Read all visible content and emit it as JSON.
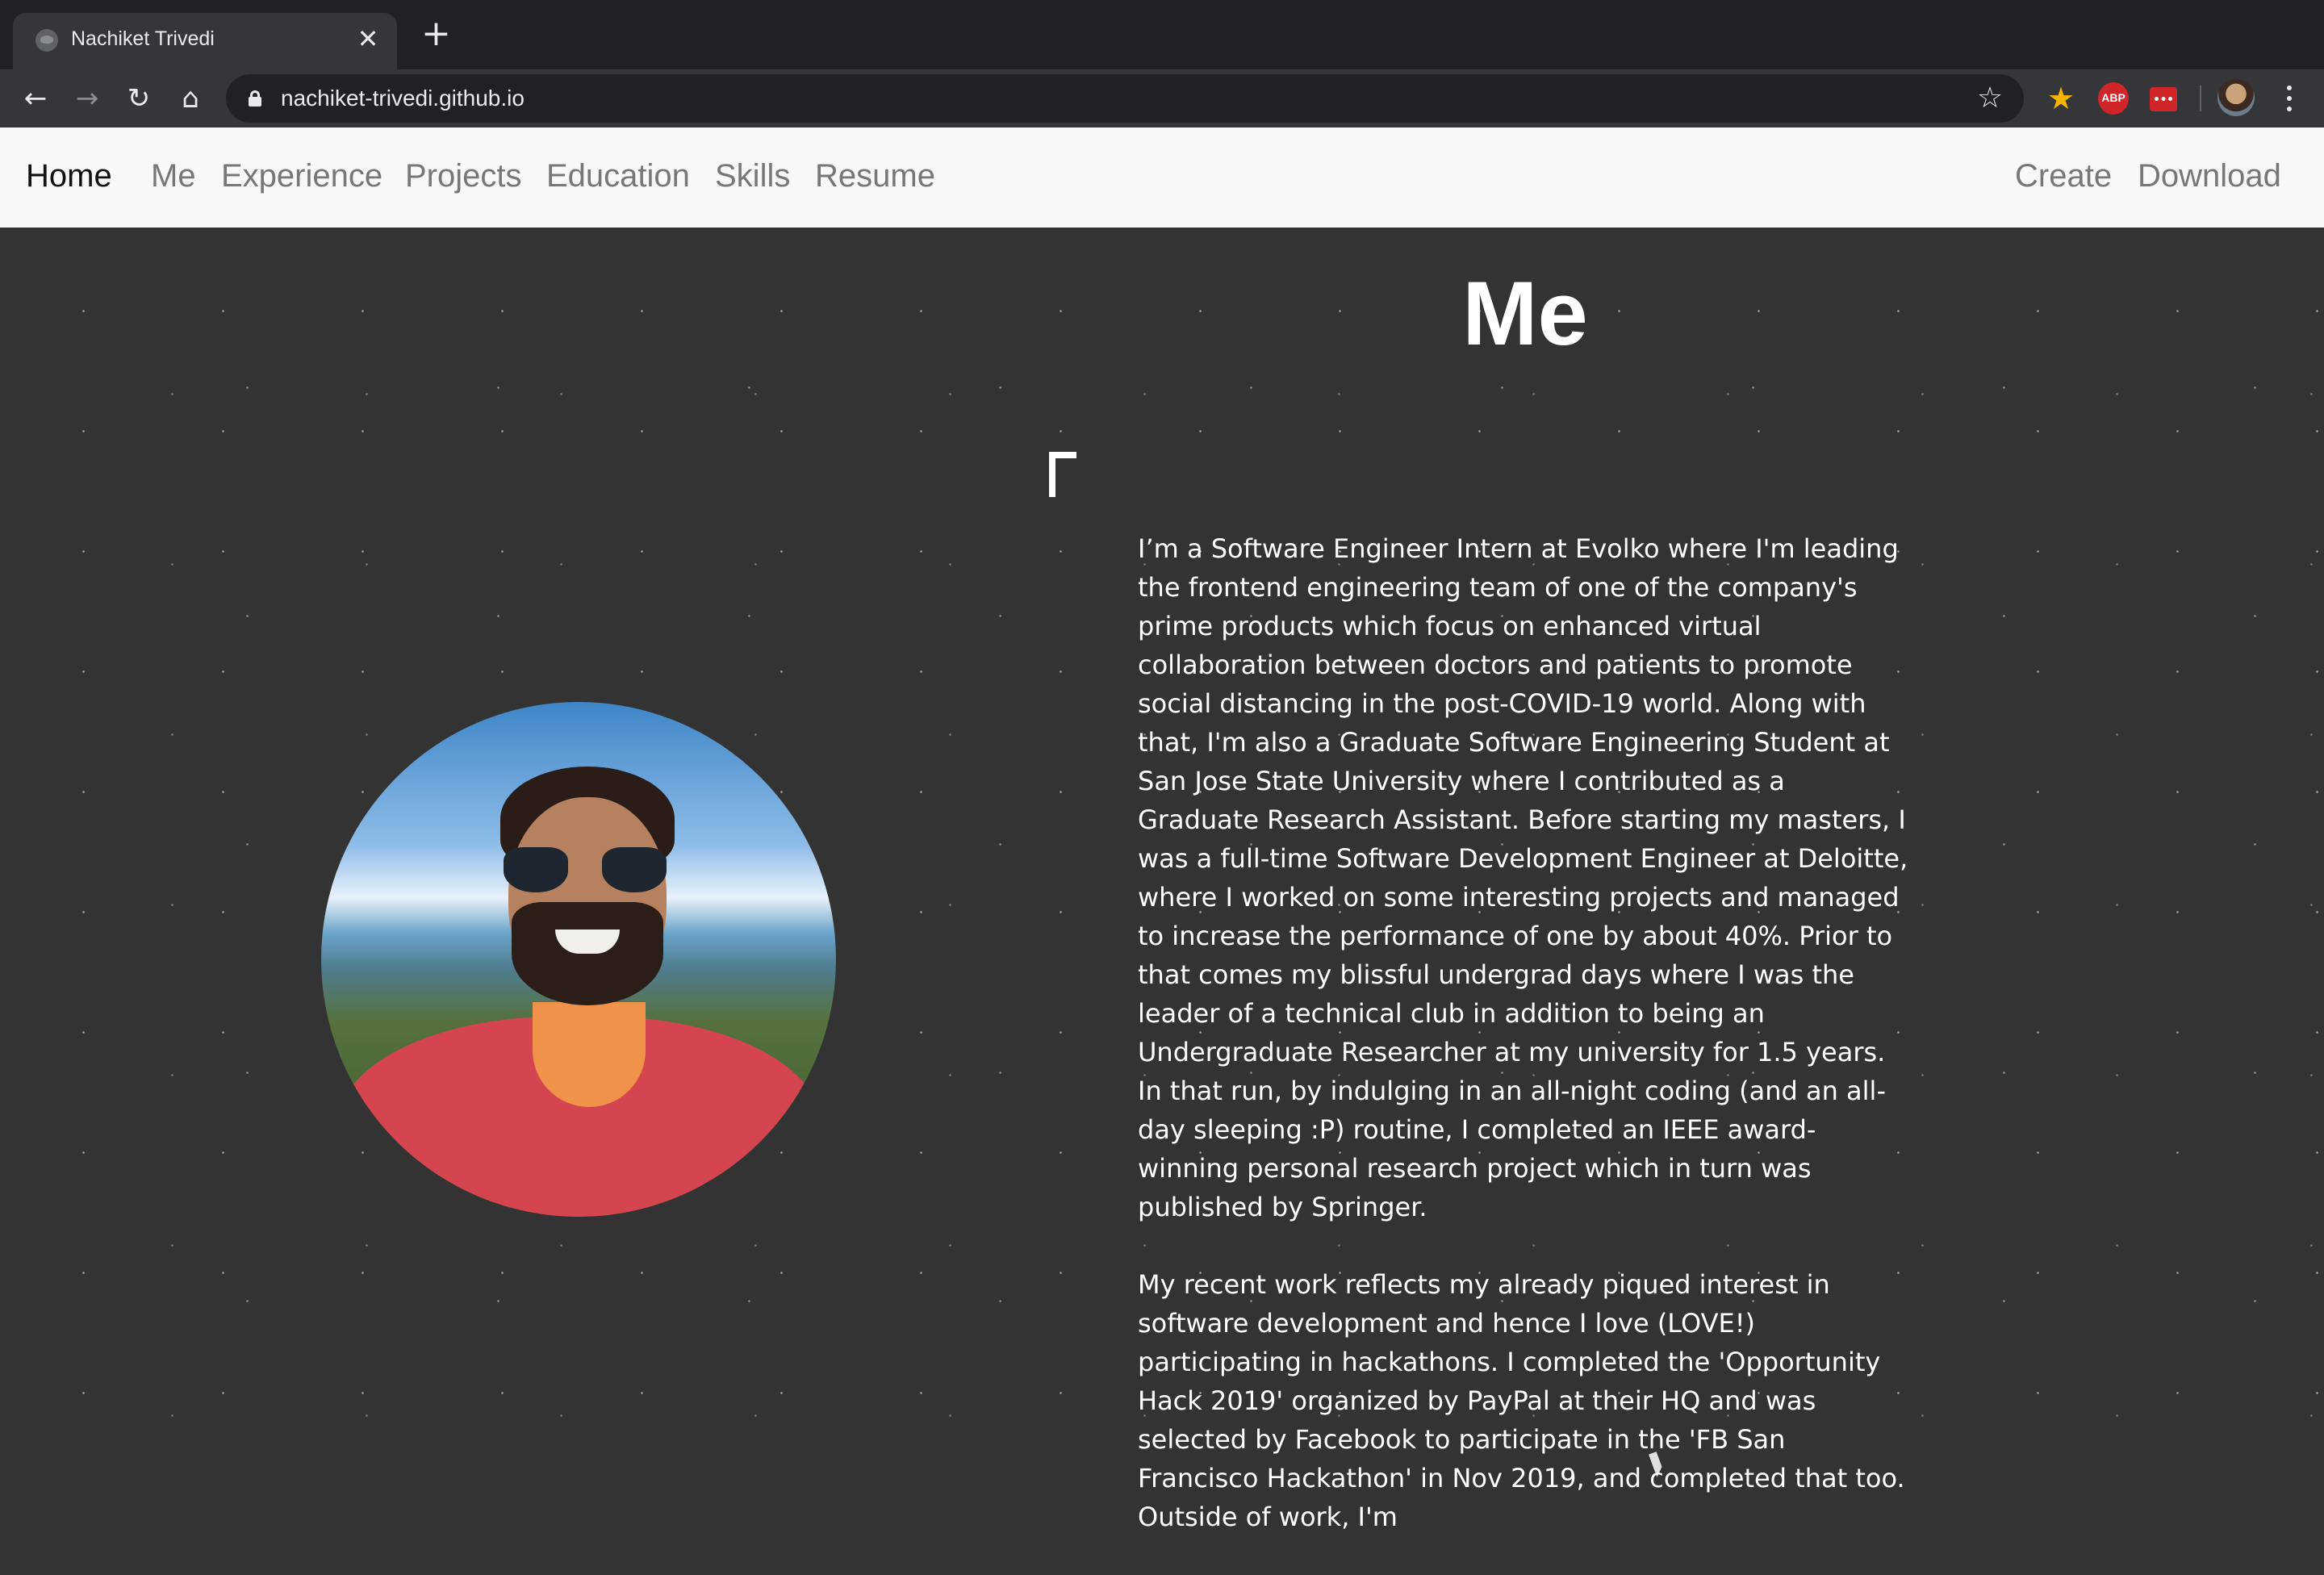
{
  "browser": {
    "tab_title": "Nachiket Trivedi",
    "tab_close": "✕",
    "new_tab": "+",
    "url": "nachiket-trivedi.github.io",
    "back": "←",
    "forward": "→",
    "reload": "↻",
    "home": "⌂",
    "bookmark_star": "☆",
    "ext_star": "★",
    "ext_abp_label": "ABP"
  },
  "navbar": {
    "brand": "Home",
    "links": [
      "Me",
      "Experience",
      "Projects",
      "Education",
      "Skills",
      "Resume"
    ],
    "right_links": [
      "Create",
      "Download"
    ]
  },
  "section": {
    "title": "Me"
  },
  "bio": {
    "paragraphs": [
      "I’m a Software Engineer Intern at Evolko where I'm leading the frontend engineering team of one of the company's prime products which focus on enhanced virtual collaboration between doctors and patients to promote social distancing in the post-COVID-19 world. Along with that, I'm also a Graduate Software Engineering Student at San Jose State University where I contributed as a Graduate Research Assistant. Before starting my masters, I was a full-time Software Development Engineer at Deloitte, where I worked on some interesting projects and managed to increase the performance of one by about 40%. Prior to that comes my blissful undergrad days where I was the leader of a technical club in addition to being an Undergraduate Researcher at my university for 1.5 years. In that run, by indulging in an all-night coding (and an all-day sleeping :P) routine, I completed an IEEE award-winning personal research project which in turn was published by Springer.",
      "My recent work reflects my already piqued interest in software development and hence I love (LOVE!) participating in hackathons. I completed the 'Opportunity Hack 2019' organized by PayPal at their HQ and was selected by Facebook to participate in the 'FB San Francisco Hackathon' in Nov 2019, and completed that too. Outside of work, I'm"
    ]
  },
  "colors": {
    "page_background": "#333333",
    "navbar_background": "#f8f8f8",
    "chrome_dark": "#202124",
    "chrome_toolbar": "#35363a"
  }
}
